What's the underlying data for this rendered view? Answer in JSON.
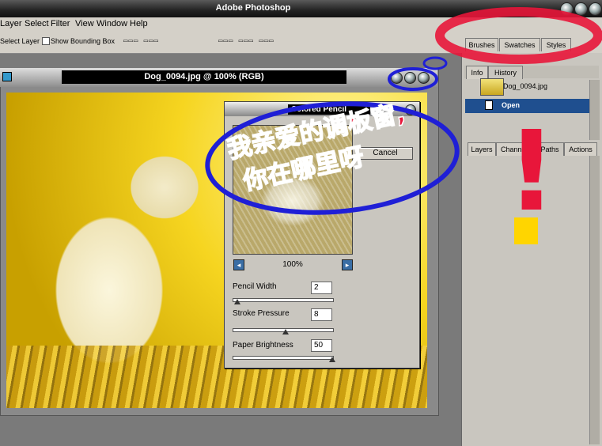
{
  "app": {
    "title": "Adobe Photoshop"
  },
  "menu": {
    "items": [
      "Layer",
      "Select",
      "Filter",
      "View",
      "Window",
      "Help"
    ]
  },
  "options": {
    "select_layer_label": "Select Layer",
    "show_bbox_label": "Show Bounding Box"
  },
  "document": {
    "title": "Dog_0094.jpg @ 100% (RGB)"
  },
  "filter_dialog": {
    "title": "Colored Pencil",
    "cancel_label": "Cancel",
    "zoom": "100%",
    "params": [
      {
        "label": "Pencil Width",
        "value": "2",
        "level": 0.05
      },
      {
        "label": "Stroke Pressure",
        "value": "8",
        "level": 0.53
      },
      {
        "label": "Paper Brightness",
        "value": "50",
        "level": 1.0
      }
    ]
  },
  "panels": {
    "top_tabs": [
      "Brushes",
      "Swatches",
      "Styles"
    ],
    "history_tabs": [
      "Info",
      "History"
    ],
    "history_items": [
      {
        "label": "Dog_0094.jpg"
      },
      {
        "label": "Open"
      }
    ],
    "bottom_tabs": [
      "Layers",
      "Channels",
      "Paths",
      "Actions"
    ]
  },
  "annotation": {
    "text_line1": "我亲爱的调板窗,",
    "text_line2": "你在哪里呀",
    "exclaim": "!"
  },
  "colors": {
    "annotation_blue": "#1f1fd6",
    "annotation_red": "#e8163a",
    "accent_yellow": "#ffd500"
  }
}
